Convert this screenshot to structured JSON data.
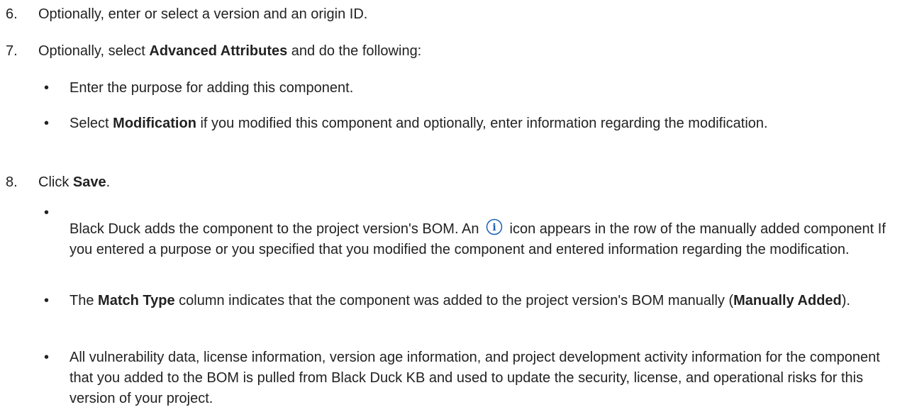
{
  "steps": [
    {
      "num": "6.",
      "text": "Optionally, enter or select a version and an origin ID."
    },
    {
      "num": "7.",
      "pre": "Optionally, select ",
      "bold": "Advanced Attributes",
      "post": " and do the following:"
    },
    {
      "num": "8.",
      "pre": "Click ",
      "bold": "Save",
      "post": "."
    }
  ],
  "step7_bullets": [
    {
      "text": "Enter the purpose for adding this component."
    },
    {
      "pre": "Select ",
      "bold": "Modification",
      "post": " if you modified this component and optionally, enter information regarding the modification."
    }
  ],
  "step8_bullets": [
    {
      "line1_pre": "Black Duck adds the component to the project version's BOM. An ",
      "line1_post": " icon appears in the row of",
      "rest": "the manually added component If you entered a purpose or you specified that you modified the component and entered information regarding the modification.",
      "icon": "info-icon"
    },
    {
      "pre": "The ",
      "bold": "Match Type",
      "mid": " column indicates that the component was added to the project version's BOM manually (",
      "bold2": "Manually Added",
      "post": ")."
    },
    {
      "text": "All vulnerability data, license information, version age information, and project development activity information for the component that you added to the BOM is pulled from Black Duck KB and used to update the security, license, and operational risks for this version of your project."
    }
  ],
  "bullet_glyph": "•",
  "colors": {
    "text": "#222222",
    "icon": "#1a5fb4"
  }
}
